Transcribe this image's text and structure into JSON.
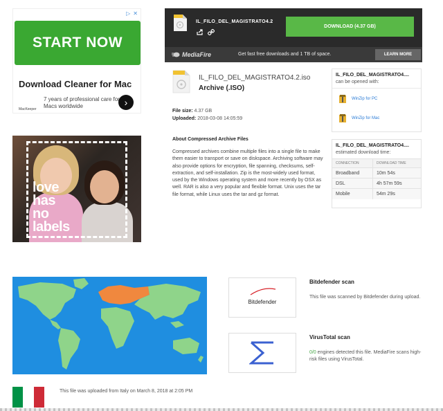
{
  "ad": {
    "button_label": "START NOW",
    "title": "Download Cleaner for Mac",
    "brand": "MacKeeper",
    "description": "7 years of professional care for Macs worldwide",
    "arrow_icon": "chevron-right-icon"
  },
  "download_bar": {
    "filename": "IL_FILO_DEL_MAGISTRATO4.2",
    "download_button": "DOWNLOAD (4.37 GB)",
    "logo_text": "MediaFire",
    "promo_text": "Get fast free downloads and 1 TB of space.",
    "learn_more": "LEARN MORE",
    "colors": {
      "bar": "#2a2a2a",
      "button": "#59b847"
    }
  },
  "file": {
    "name": "IL_FILO_DEL_MAGISTRATO4.2.iso",
    "type": "Archive (.ISO)",
    "size_label": "File size:",
    "size_value": "4.37 GB",
    "uploaded_label": "Uploaded:",
    "uploaded_value": "2018-03-08 14:05:59",
    "about_title": "About Compressed Archive Files",
    "about_text": "Compressed archives combine multiple files into a single file to make them easier to transport or save on diskspace. Archiving software may also provide options for encryption, file spanning, checksums, self-extraction, and self-installation. Zip is the most-widely used format, used by the Windows operating system and more recently by OSX as well. RAR is also a very popular and flexible format. Unix uses the tar file format, while Linux uses the tar and gz format."
  },
  "open_with": {
    "title": "IL_FILO_DEL_MAGISTRATO4....",
    "subtitle": "can be opened with:",
    "apps": [
      {
        "label": "WinZip for PC"
      },
      {
        "label": "WinZip for Mac"
      }
    ]
  },
  "download_time": {
    "title": "IL_FILO_DEL_MAGISTRATO4....",
    "subtitle": "estimated download time:",
    "columns": [
      "CONNECTION",
      "DOWNLOAD TIME"
    ],
    "rows": [
      {
        "connection": "Broadband",
        "time": "10m 54s"
      },
      {
        "connection": "DSL",
        "time": "4h 57m 59s"
      },
      {
        "connection": "Mobile",
        "time": "54m 29s"
      }
    ]
  },
  "campaign": {
    "text_lines": [
      "love",
      "has",
      "no",
      "labels"
    ]
  },
  "map": {
    "colors": {
      "ocean": "#1f8ee0",
      "land": "#8fd48a",
      "highlight": "#f0883e"
    }
  },
  "scans": {
    "bitdefender": {
      "logo_word": "Bitdefender",
      "title": "Bitdefender scan",
      "text": "This file was scanned by Bitdefender during upload."
    },
    "virustotal": {
      "title": "VirusTotal scan",
      "ratio": "0/0",
      "text": " engines detected this file. MediaFire scans high-risk files using VirusTotal."
    }
  },
  "upload_location": {
    "text": "This file was uploaded from Italy on March 8, 2018 at 2:05 PM",
    "flag_colors": [
      "#009246",
      "#ffffff",
      "#ce2b37"
    ]
  }
}
